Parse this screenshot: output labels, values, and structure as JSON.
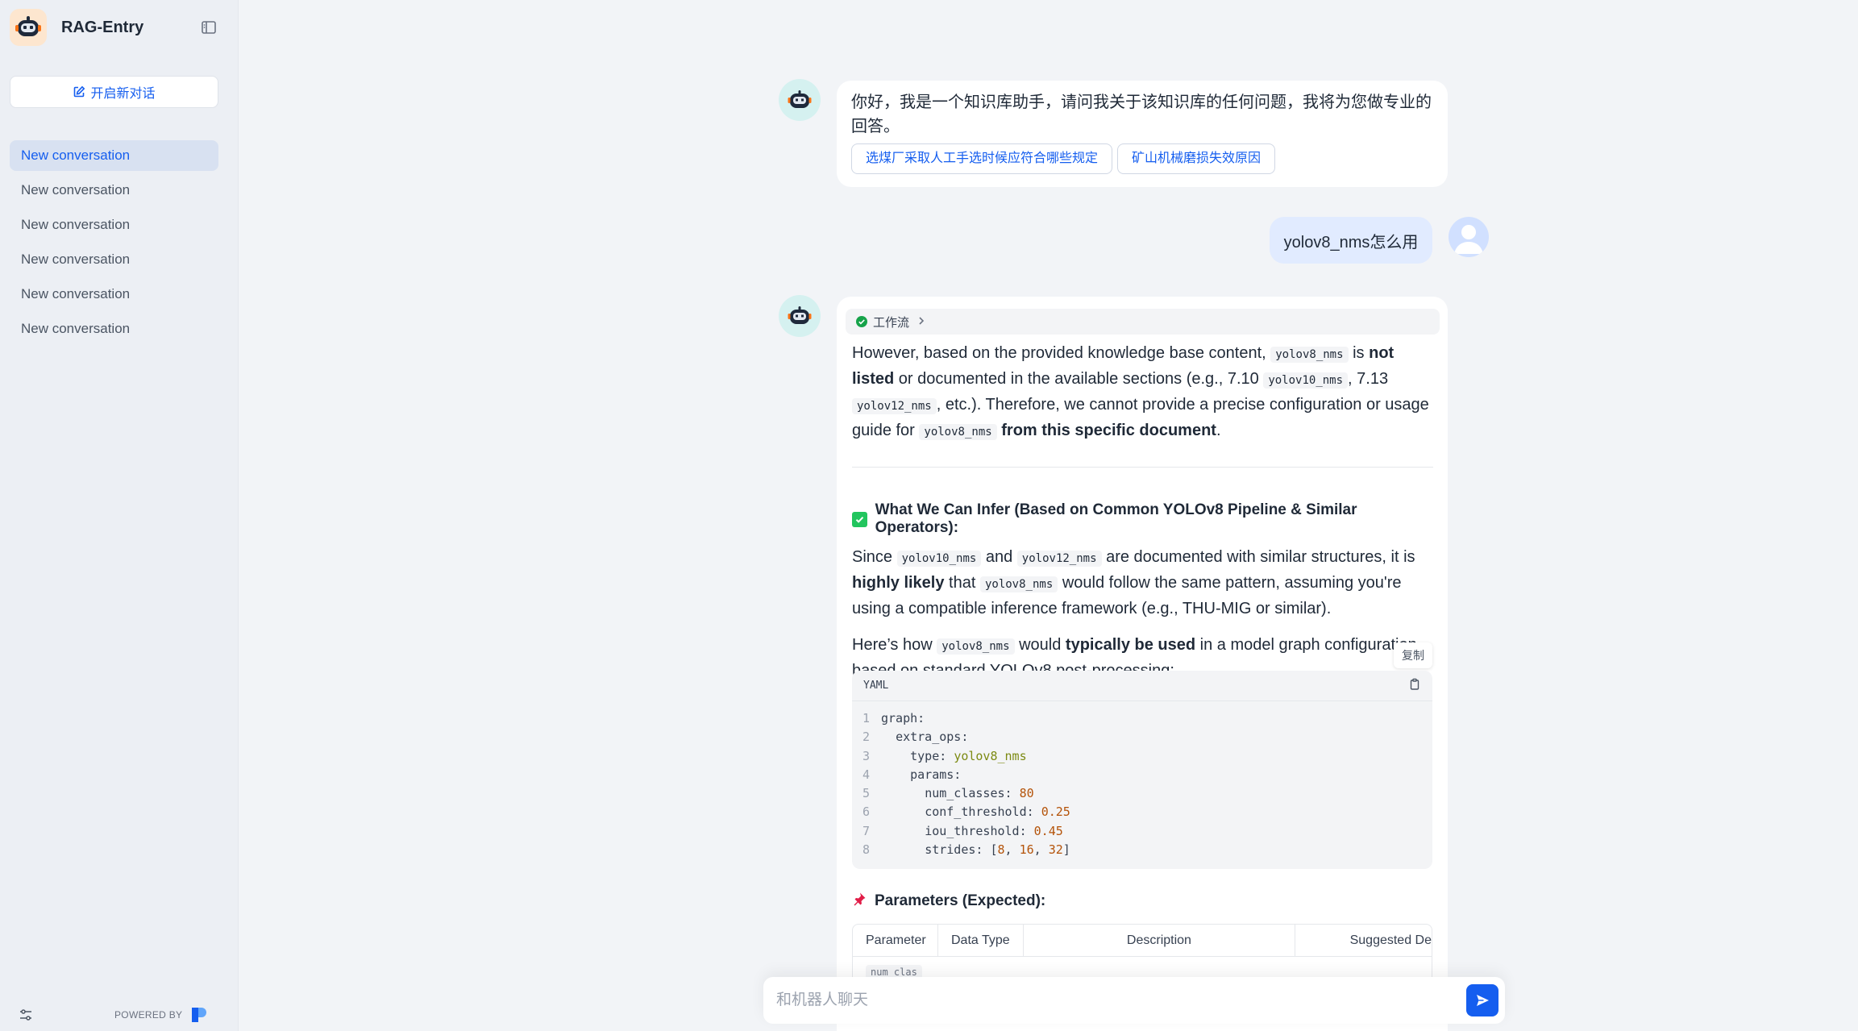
{
  "app": {
    "title": "RAG-Entry"
  },
  "sidebar": {
    "new_chat_label": "开启新对话",
    "conversations": [
      {
        "label": "New conversation",
        "active": true
      },
      {
        "label": "New conversation",
        "active": false
      },
      {
        "label": "New conversation",
        "active": false
      },
      {
        "label": "New conversation",
        "active": false
      },
      {
        "label": "New conversation",
        "active": false
      },
      {
        "label": "New conversation",
        "active": false
      }
    ],
    "powered_by": "POWERED BY"
  },
  "chat": {
    "greeting": "你好，我是一个知识库助手，请问我关于该知识库的任何问题，我将为您做专业的回答。",
    "suggestions": [
      "选煤厂采取人工手选时候应符合哪些规定",
      "矿山机械磨损失效原因"
    ],
    "user_message": "yolov8_nms怎么用",
    "workflow_label": "工作流",
    "answer": {
      "p1": {
        "t1": "However, based on the provided knowledge base content, ",
        "c1": "yolov8_nms",
        "t2": " is ",
        "b1": "not listed",
        "t3": " or documented in the available sections (e.g., 7.10 ",
        "c2": "yolov10_nms",
        "t4": ", 7.13 ",
        "c3": "yolov12_nms",
        "t5": ", etc.). Therefore, we cannot provide a precise configuration or usage guide for ",
        "c4": "yolov8_nms",
        "t6": " ",
        "b2": "from this specific document",
        "t7": "."
      },
      "heading1": "What We Can Infer (Based on Common YOLOv8 Pipeline & Similar Operators):",
      "p2": {
        "t1": "Since ",
        "c1": "yolov10_nms",
        "t2": " and ",
        "c2": "yolov12_nms",
        "t3": " are documented with similar structures, it is ",
        "b1": "highly likely",
        "t4": " that ",
        "c3": "yolov8_nms",
        "t5": " would follow the same pattern, assuming you're using a compatible inference framework (e.g., THU-MIG or similar)."
      },
      "p3": {
        "t1": "Here’s how ",
        "c1": "yolov8_nms",
        "t2": " would ",
        "b1": "typically be used",
        "t3": " in a model graph configuration, based on standard YOLOv8 post-processing:"
      },
      "copy_label": "复制",
      "code": {
        "lang": "YAML",
        "lines": [
          {
            "n": "1",
            "indent": "",
            "key": "graph:",
            "val": "",
            "type": ""
          },
          {
            "n": "2",
            "indent": "  ",
            "key": "extra_ops:",
            "val": "",
            "type": ""
          },
          {
            "n": "3",
            "indent": "    ",
            "key": "type: ",
            "val": "yolov8_nms",
            "type": "str"
          },
          {
            "n": "4",
            "indent": "    ",
            "key": "params:",
            "val": "",
            "type": ""
          },
          {
            "n": "5",
            "indent": "      ",
            "key": "num_classes: ",
            "val": "80",
            "type": "num"
          },
          {
            "n": "6",
            "indent": "      ",
            "key": "conf_threshold: ",
            "val": "0.25",
            "type": "num"
          },
          {
            "n": "7",
            "indent": "      ",
            "key": "iou_threshold: ",
            "val": "0.45",
            "type": "num"
          },
          {
            "n": "8",
            "indent": "      ",
            "key": "strides: ",
            "val": "[8, 16, 32]",
            "type": "arr"
          }
        ]
      },
      "heading2": "Parameters (Expected):",
      "table": {
        "headers": [
          "Parameter",
          "Data Type",
          "Description",
          "Suggested De"
        ],
        "first_cell": "num_clas"
      }
    }
  },
  "input": {
    "placeholder": "和机器人聊天"
  },
  "colors": {
    "accent": "#155eef",
    "sidebar_bg": "#eceff4",
    "page_bg": "#f2f4f7",
    "user_bubble": "#e1ebff"
  }
}
